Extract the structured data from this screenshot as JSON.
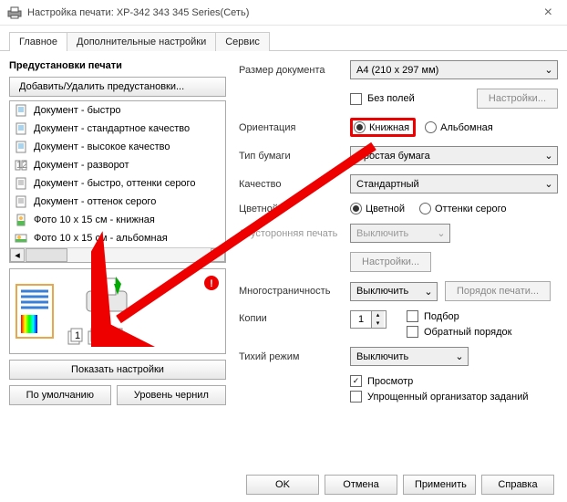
{
  "titlebar": {
    "title": "Настройка печати: XP-342 343 345 Series(Сеть)"
  },
  "tabs": {
    "main": "Главное",
    "extra": "Дополнительные настройки",
    "service": "Сервис"
  },
  "presets": {
    "title": "Предустановки печати",
    "add_remove": "Добавить/Удалить предустановки...",
    "items": [
      "Документ - быстро",
      "Документ - стандартное качество",
      "Документ - высокое качество",
      "Документ - разворот",
      "Документ - быстро, оттенки серого",
      "Документ - оттенок серого",
      "Фото 10 x 15 см - книжная",
      "Фото 10 x 15 см - альбомная"
    ]
  },
  "left_buttons": {
    "show": "Показать настройки",
    "default": "По умолчанию",
    "ink": "Уровень чернил"
  },
  "settings": {
    "doc_size_label": "Размер документа",
    "doc_size_value": "A4 (210 x 297 мм)",
    "borderless": "Без полей",
    "settings_btn": "Настройки...",
    "orientation_label": "Ориентация",
    "orientation_portrait": "Книжная",
    "orientation_landscape": "Альбомная",
    "paper_type_label": "Тип бумаги",
    "paper_type_value": "Простая бумага",
    "quality_label": "Качество",
    "quality_value": "Стандартный",
    "color_label": "Цветной",
    "color_color": "Цветной",
    "color_gray": "Оттенки серого",
    "duplex_label": "Двусторонняя печать",
    "duplex_value": "Выключить",
    "duplex_settings": "Настройки...",
    "multipage_label": "Многостраничность",
    "multipage_value": "Выключить",
    "multipage_order": "Порядок печати...",
    "copies_label": "Копии",
    "copies_value": "1",
    "collate": "Подбор",
    "reverse": "Обратный порядок",
    "quiet_label": "Тихий режим",
    "quiet_value": "Выключить",
    "preview": "Просмотр",
    "simple_org": "Упрощенный организатор заданий"
  },
  "footer": {
    "ok": "OK",
    "cancel": "Отмена",
    "apply": "Применить",
    "help": "Справка"
  }
}
